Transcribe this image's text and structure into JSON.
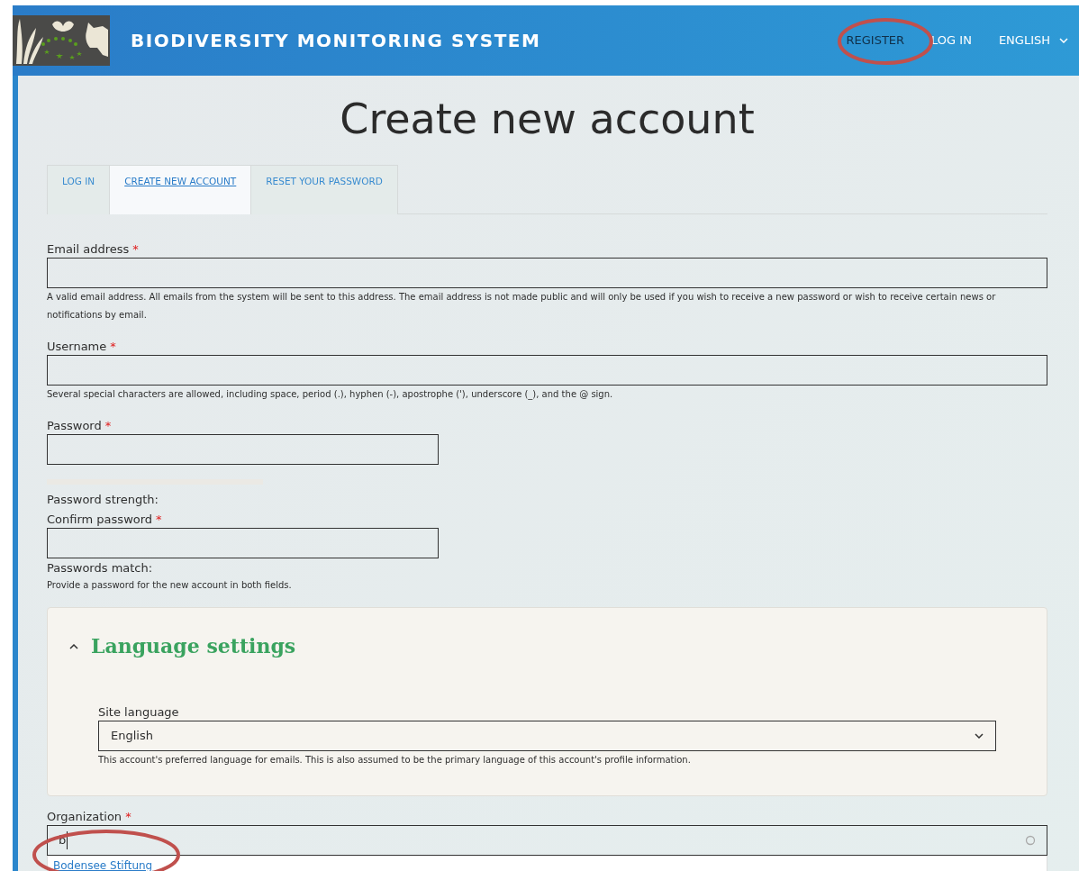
{
  "header": {
    "site_name": "BIODIVERSITY MONITORING SYSTEM",
    "nav": [
      {
        "label": "REGISTER",
        "selected": true
      },
      {
        "label": "LOG IN",
        "selected": false
      }
    ],
    "language": "ENGLISH"
  },
  "page_title": "Create new account",
  "tabs": [
    {
      "label": "LOG IN",
      "selected": false
    },
    {
      "label": "CREATE NEW ACCOUNT",
      "selected": true
    },
    {
      "label": "RESET YOUR PASSWORD",
      "selected": false
    }
  ],
  "fields": [
    {
      "label": "Email address",
      "required_mark": "*",
      "kind": "wide",
      "help": "A valid email address. All emails from the system will be sent to this address. The email address is not made public and will only be used if you wish to receive a new password or wish to receive certain news or notifications by email."
    },
    {
      "label": "Username",
      "required_mark": "*",
      "kind": "wide",
      "help": "Several special characters are allowed, including space, period (.), hyphen (-), apostrophe ('), underscore (_), and the @ sign."
    },
    {
      "label": "Password",
      "required_mark": "*",
      "kind": "short",
      "strength_label": "Password strength:",
      "strength_meter": {
        "level": 0
      }
    },
    {
      "label": "Confirm password",
      "required_mark": "*",
      "kind": "short",
      "match_label": "Passwords match:",
      "help": "Provide a password for the new account in both fields."
    }
  ],
  "language_settings": {
    "title": "Language settings",
    "expanded": true,
    "label": "Site language",
    "value": "English",
    "help": "This account's preferred language for emails. This is also assumed to be the primary language of this account's profile information."
  },
  "organization": {
    "label": "Organization",
    "required_mark": "*",
    "value": "b",
    "suggestions": [
      "Bodensee Stiftung"
    ]
  }
}
